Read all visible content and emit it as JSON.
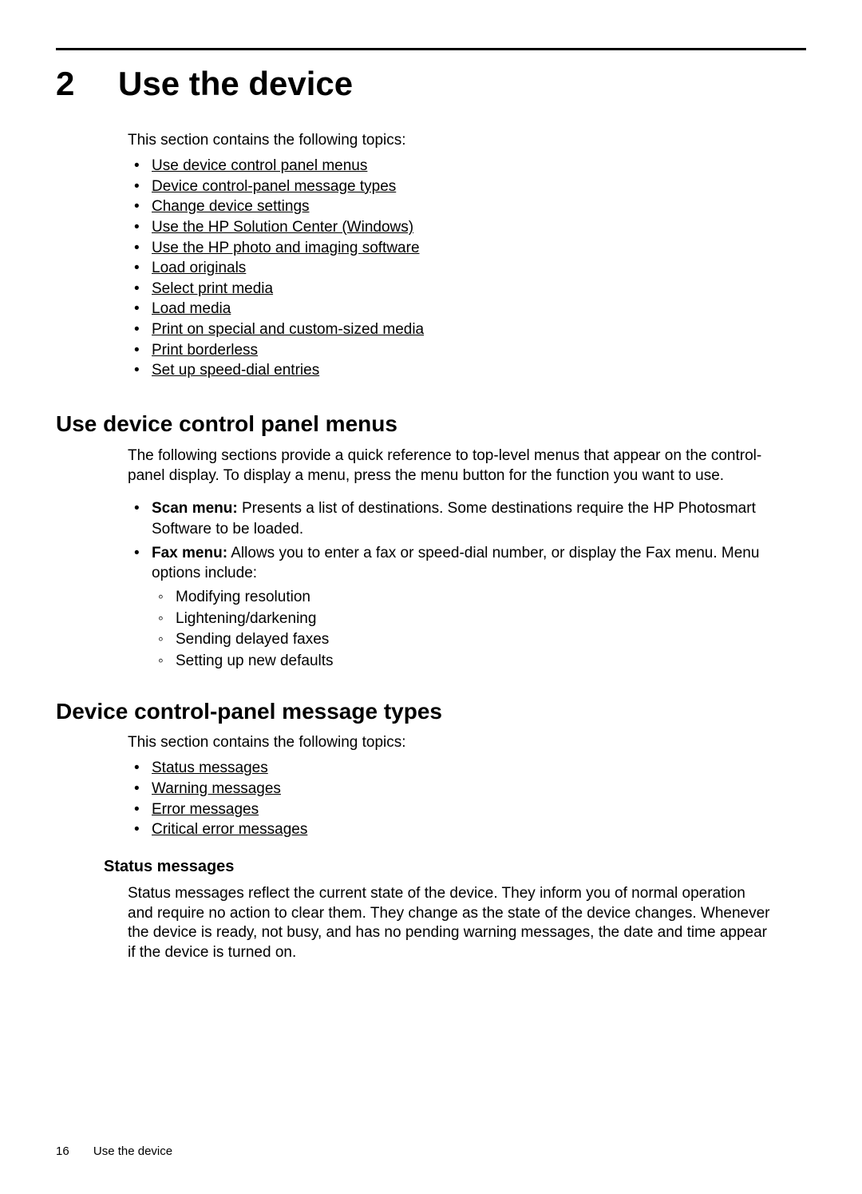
{
  "chapter": {
    "number": "2",
    "title": "Use the device"
  },
  "intro": "This section contains the following topics:",
  "topics": [
    "Use device control panel menus",
    "Device control-panel message types",
    "Change device settings",
    "Use the HP Solution Center (Windows)",
    "Use the HP photo and imaging software",
    "Load originals",
    "Select print media",
    "Load media",
    "Print on special and custom-sized media",
    "Print borderless",
    "Set up speed-dial entries"
  ],
  "section1": {
    "heading": "Use device control panel menus",
    "body": "The following sections provide a quick reference to top-level menus that appear on the control-panel display. To display a menu, press the menu button for the function you want to use.",
    "item1_label": "Scan menu:",
    "item1_text": " Presents a list of destinations. Some destinations require the HP Photosmart Software to be loaded.",
    "item2_label": "Fax menu:",
    "item2_text": " Allows you to enter a fax or speed-dial number, or display the Fax menu. Menu options include:",
    "sub_items": [
      "Modifying resolution",
      "Lightening/darkening",
      "Sending delayed faxes",
      "Setting up new defaults"
    ]
  },
  "section2": {
    "heading": "Device control-panel message types",
    "intro": "This section contains the following topics:",
    "links": [
      "Status messages",
      "Warning messages",
      "Error messages",
      "Critical error messages"
    ],
    "sub_heading": "Status messages",
    "sub_body": "Status messages reflect the current state of the device. They inform you of normal operation and require no action to clear them. They change as the state of the device changes. Whenever the device is ready, not busy, and has no pending warning messages, the date and time appear if the device is turned on."
  },
  "footer": {
    "page": "16",
    "title": "Use the device"
  }
}
